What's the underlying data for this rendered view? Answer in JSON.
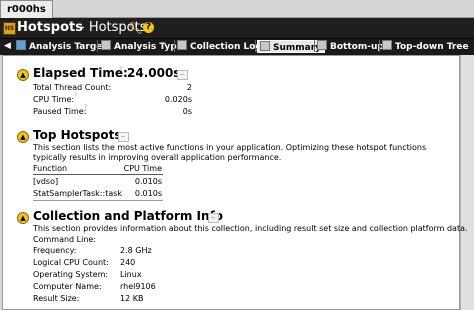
{
  "tab": {
    "label": "r000hs"
  },
  "header": {
    "title": "Hotspots",
    "subtitle": "- Hotspots"
  },
  "nav": [
    {
      "label": "Analysis Target",
      "icon": "play-icon"
    },
    {
      "label": "Analysis Type",
      "icon": "analysis-type-icon"
    },
    {
      "label": "Collection Log",
      "icon": "log-icon"
    },
    {
      "label": "Summary",
      "icon": "summary-icon",
      "active": true
    },
    {
      "label": "Bottom-up",
      "icon": "bottom-up-icon"
    },
    {
      "label": "Top-down Tree",
      "icon": "tree-icon"
    }
  ],
  "elapsed": {
    "label": "Elapsed Time:",
    "value": "24.000s",
    "rows": [
      {
        "label": "Total Thread Count:",
        "value": "2"
      },
      {
        "label": "CPU Time:",
        "value": "0.020s"
      },
      {
        "label": "Paused Time:",
        "value": "0s"
      }
    ]
  },
  "hotspots": {
    "title": "Top Hotspots",
    "description": "This section lists the most active functions in your application. Optimizing these hotspot functions typically results in improving overall application performance.",
    "columns": [
      "Function",
      "CPU Time"
    ],
    "rows": [
      {
        "function": "[vdso]",
        "cpu_time": "0.010s"
      },
      {
        "function": "StatSamplerTask::task",
        "cpu_time": "0.010s"
      }
    ]
  },
  "platform": {
    "title": "Collection and Platform Info",
    "description": "This section provides information about this collection, including result set size and collection platform data.",
    "command_line_label": "Command Line:",
    "rows": [
      {
        "label": "Frequency:",
        "value": "2.8 GHz"
      },
      {
        "label": "Logical CPU Count:",
        "value": "240"
      },
      {
        "label": "Operating System:",
        "value": "Linux"
      },
      {
        "label": "Computer Name:",
        "value": "rhel9106"
      },
      {
        "label": "Result Size:",
        "value": "12 KB"
      }
    ]
  }
}
